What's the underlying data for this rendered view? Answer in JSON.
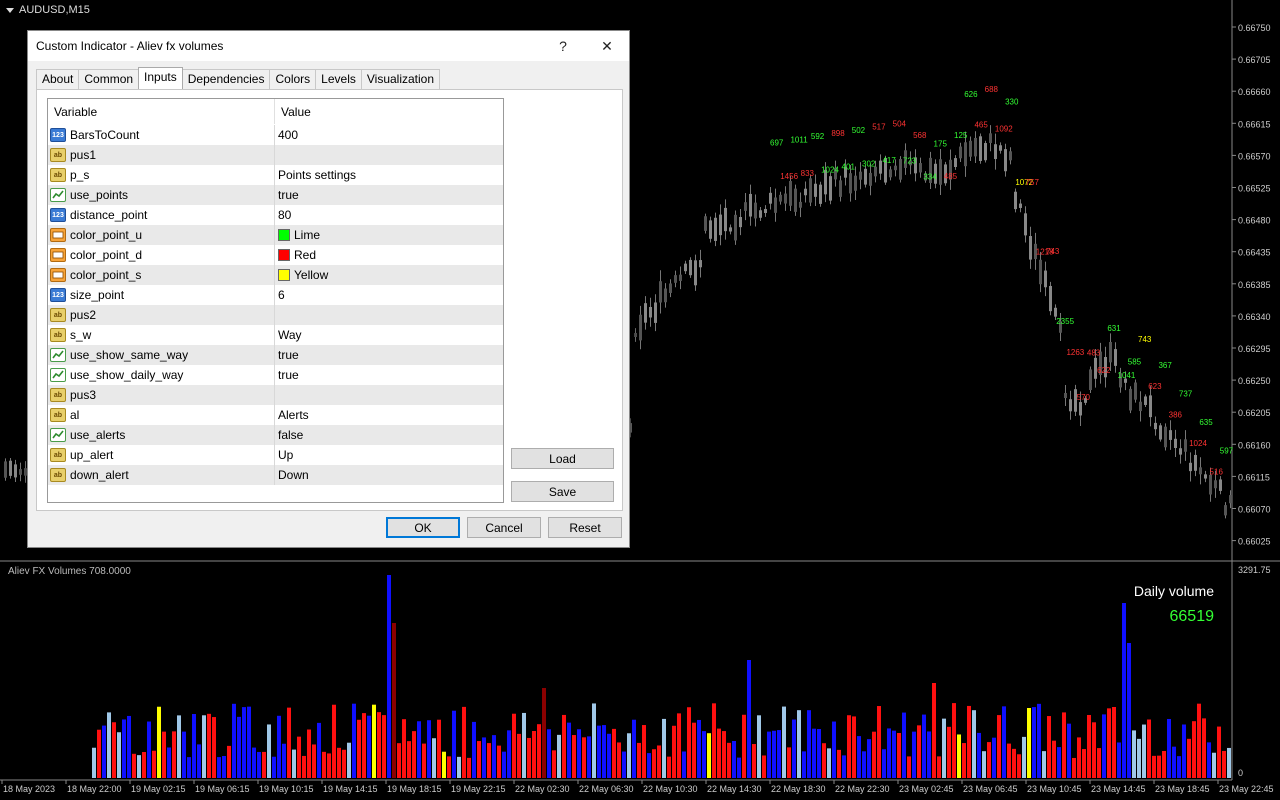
{
  "window": {
    "symbol_label": "AUDUSD,M15"
  },
  "dialog": {
    "title": "Custom Indicator - Aliev fx volumes",
    "help_label": "?",
    "close_label": "✕",
    "tabs": [
      "About",
      "Common",
      "Inputs",
      "Dependencies",
      "Colors",
      "Levels",
      "Visualization"
    ],
    "active_tab": "Inputs",
    "grid_headers": {
      "variable": "Variable",
      "value": "Value"
    },
    "rows": [
      {
        "type": "int",
        "name": "BarsToCount",
        "value": "400"
      },
      {
        "type": "str",
        "name": "pus1",
        "value": ""
      },
      {
        "type": "str",
        "name": "p_s",
        "value": "Points settings"
      },
      {
        "type": "bool",
        "name": "use_points",
        "value": "true"
      },
      {
        "type": "int",
        "name": "distance_point",
        "value": "80"
      },
      {
        "type": "color",
        "name": "color_point_u",
        "value": "Lime",
        "swatch": "#00ff00"
      },
      {
        "type": "color",
        "name": "color_point_d",
        "value": "Red",
        "swatch": "#ff0000"
      },
      {
        "type": "color",
        "name": "color_point_s",
        "value": "Yellow",
        "swatch": "#ffff00"
      },
      {
        "type": "int",
        "name": "size_point",
        "value": "6"
      },
      {
        "type": "str",
        "name": "pus2",
        "value": ""
      },
      {
        "type": "str",
        "name": "s_w",
        "value": "Way"
      },
      {
        "type": "bool",
        "name": "use_show_same_way",
        "value": "true"
      },
      {
        "type": "bool",
        "name": "use_show_daily_way",
        "value": "true"
      },
      {
        "type": "str",
        "name": "pus3",
        "value": ""
      },
      {
        "type": "str",
        "name": "al",
        "value": "Alerts"
      },
      {
        "type": "bool",
        "name": "use_alerts",
        "value": "false"
      },
      {
        "type": "str",
        "name": "up_alert",
        "value": "Up"
      },
      {
        "type": "str",
        "name": "down_alert",
        "value": "Down"
      }
    ],
    "buttons": {
      "load": "Load",
      "save": "Save",
      "ok": "OK",
      "cancel": "Cancel",
      "reset": "Reset"
    }
  },
  "price_axis": [
    "0.66750",
    "0.66705",
    "0.66660",
    "0.66615",
    "0.66570",
    "0.66525",
    "0.66480",
    "0.66435",
    "0.66385",
    "0.66340",
    "0.66295",
    "0.66250",
    "0.66205",
    "0.66160",
    "0.66115",
    "0.66070",
    "0.66025"
  ],
  "time_axis": [
    "18 May 2023",
    "18 May 22:00",
    "19 May 02:15",
    "19 May 06:15",
    "19 May 10:15",
    "19 May 14:15",
    "19 May 18:15",
    "19 May 22:15",
    "22 May 02:30",
    "22 May 06:30",
    "22 May 10:30",
    "22 May 14:30",
    "22 May 18:30",
    "22 May 22:30",
    "23 May 02:45",
    "23 May 06:45",
    "23 May 10:45",
    "23 May 14:45",
    "23 May 18:45",
    "23 May 22:45"
  ],
  "subwindow": {
    "title": "Aliev FX Volumes 708.0000",
    "scale_max": "3291.75",
    "scale_min": "0",
    "daily_volume_label": "Daily volume",
    "daily_volume_value": "66519"
  },
  "colors": {
    "volume_up": "#1010ff",
    "volume_down": "#ff1010",
    "volume_same": "#a0c8e8",
    "volume_highlight": "#ffff00",
    "volume_dark": "#8b0000",
    "label_up": "#33ff33",
    "label_down": "#ff3333"
  },
  "point_labels": [
    {
      "t": "697",
      "c": "up"
    },
    {
      "t": "1456",
      "c": "dn"
    },
    {
      "t": "1011",
      "c": "up"
    },
    {
      "t": "833",
      "c": "dn"
    },
    {
      "t": "592",
      "c": "up"
    },
    {
      "t": "1024",
      "c": "up"
    },
    {
      "t": "898",
      "c": "dn"
    },
    {
      "t": "401",
      "c": "up"
    },
    {
      "t": "502",
      "c": "up"
    },
    {
      "t": "302",
      "c": "up"
    },
    {
      "t": "517",
      "c": "dn"
    },
    {
      "t": "417",
      "c": "up"
    },
    {
      "t": "504",
      "c": "dn"
    },
    {
      "t": "723",
      "c": "up"
    },
    {
      "t": "568",
      "c": "dn"
    },
    {
      "t": "334",
      "c": "up"
    },
    {
      "t": "175",
      "c": "up"
    },
    {
      "t": "485",
      "c": "dn"
    },
    {
      "t": "125",
      "c": "up"
    },
    {
      "t": "626",
      "c": "up"
    },
    {
      "t": "465",
      "c": "dn"
    },
    {
      "t": "688",
      "c": "dn"
    },
    {
      "t": "1092",
      "c": "dn"
    },
    {
      "t": "330",
      "c": "up"
    },
    {
      "t": "1072",
      "c": "hl"
    },
    {
      "t": "757",
      "c": "dn"
    },
    {
      "t": "1218",
      "c": "dn"
    },
    {
      "t": "743",
      "c": "dn"
    },
    {
      "t": "2355",
      "c": "up"
    },
    {
      "t": "1263",
      "c": "dn"
    },
    {
      "t": "570",
      "c": "dn"
    },
    {
      "t": "483",
      "c": "dn"
    },
    {
      "t": "622",
      "c": "dn"
    },
    {
      "t": "631",
      "c": "up"
    },
    {
      "t": "1041",
      "c": "up"
    },
    {
      "t": "585",
      "c": "up"
    },
    {
      "t": "743",
      "c": "hl"
    },
    {
      "t": "623",
      "c": "dn"
    },
    {
      "t": "367",
      "c": "up"
    },
    {
      "t": "386",
      "c": "dn"
    },
    {
      "t": "737",
      "c": "up"
    },
    {
      "t": "1024",
      "c": "dn"
    },
    {
      "t": "635",
      "c": "up"
    },
    {
      "t": "516",
      "c": "dn"
    },
    {
      "t": "597",
      "c": "up"
    }
  ]
}
